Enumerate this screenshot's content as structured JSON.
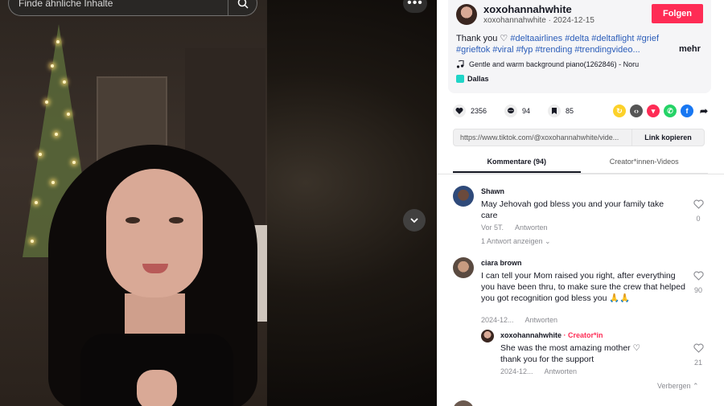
{
  "search": {
    "placeholder": "Finde ähnliche Inhalte"
  },
  "video": {
    "more_label": "•••"
  },
  "post": {
    "author": "xoxohannahwhite",
    "author_sub": "xoxohannahwhite · 2024-12-15",
    "follow_label": "Folgen",
    "caption_text": "Thank you ♡",
    "hashtags_line1": "#deltaairlines #delta #deltaflight #grief",
    "hashtags_line2": "#grieftok #viral #fyp #trending #trendingvideo...",
    "more_label": "mehr",
    "music": "Gentle and warm background piano(1262846) - Noru",
    "location": "Dallas"
  },
  "actions": {
    "likes": "2356",
    "comments": "94",
    "saves": "85"
  },
  "link": {
    "url": "https://www.tiktok.com/@xoxohannahwhite/vide...",
    "copy_label": "Link kopieren"
  },
  "tabs": [
    {
      "label": "Kommentare (94)"
    },
    {
      "label": "Creator*innen-Videos"
    }
  ],
  "comments": [
    {
      "user": "Shawn",
      "text": "May Jehovah god bless you and your family take care",
      "time": "Vor 5T.",
      "reply_label": "Antworten",
      "likes": "0",
      "view_replies": "1 Antwort anzeigen ⌄"
    },
    {
      "user": "ciara brown",
      "text": "I can tell your Mom raised you right, after everything you have been thru, to make sure the crew that helped you got recognition god bless you 🙏🙏",
      "time": "2024-12...",
      "reply_label": "Antworten",
      "likes": "90"
    }
  ],
  "reply": {
    "user": "xoxohannahwhite",
    "badge": " · Creator*in",
    "text": "She was the most amazing mother ♡ thank you for the support",
    "time": "2024-12...",
    "reply_label": "Antworten",
    "likes": "21"
  },
  "hide_replies": "Verbergen ⌃",
  "colors": {
    "accent": "#fe2c55",
    "hashtag": "#2b5db9"
  }
}
